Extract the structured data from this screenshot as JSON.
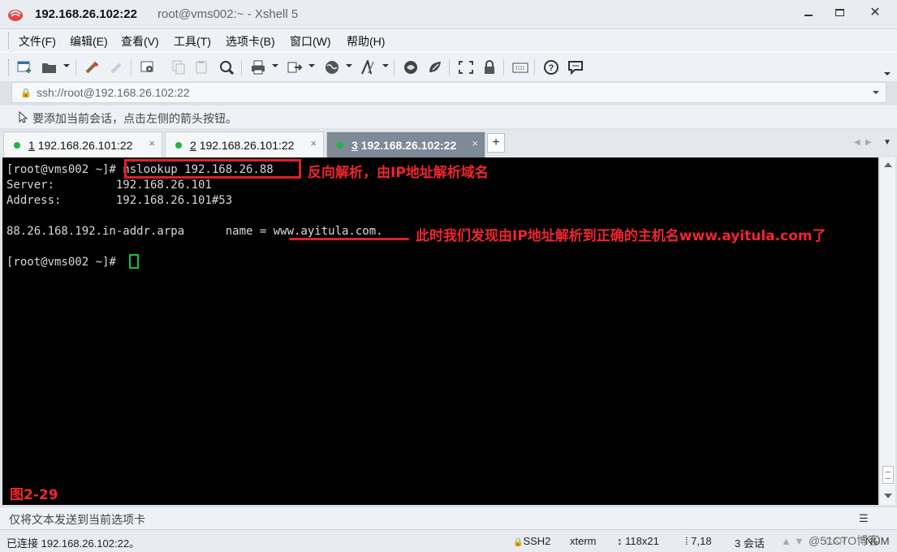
{
  "window": {
    "title_host": "192.168.26.102:22",
    "title_sub": "root@vms002:~ - Xshell 5",
    "minimize_glyph": "▭",
    "maximize_glyph": "□",
    "close_glyph": "✕"
  },
  "menu": [
    "文件(F)",
    "编辑(E)",
    "查看(V)",
    "工具(T)",
    "选项卡(B)",
    "窗口(W)",
    "帮助(H)"
  ],
  "toolbar": {
    "icons": [
      "new-session-icon",
      "open-folder-icon",
      "connect-icon",
      "disconnect-icon",
      "properties-icon",
      "copy-icon",
      "paste-icon",
      "find-icon",
      "print-icon",
      "transfer-icon",
      "globe-icon",
      "font-icon",
      "xftp-icon",
      "xmanager-icon",
      "fullscreen-icon",
      "lock-icon",
      "keyboard-icon",
      "help-icon",
      "chat-icon"
    ]
  },
  "address": {
    "url": "ssh://root@192.168.26.102:22"
  },
  "session_hint": "要添加当前会话，点击左侧的箭头按钮。",
  "tabs": [
    {
      "num": "1",
      "label": "192.168.26.101:22",
      "active": false
    },
    {
      "num": "2",
      "label": "192.168.26.101:22",
      "active": false
    },
    {
      "num": "3",
      "label": "192.168.26.102:22",
      "active": true
    }
  ],
  "tab_close_glyph": "×",
  "tab_add_glyph": "+",
  "terminal": {
    "lines": [
      "[root@vms002 ~]# nslookup 192.168.26.88",
      "Server:         192.168.26.101",
      "Address:        192.168.26.101#53",
      "",
      "88.26.168.192.in-addr.arpa      name = www.ayitula.com.",
      "",
      "[root@vms002 ~]# "
    ],
    "annotation_1": "反向解析，由IP地址解析域名",
    "annotation_2": "此时我们发现由IP地址解析到正确的主机名www.ayitula.com了",
    "figure_label": "图2-29"
  },
  "sendbar": {
    "label": "仅将文本发送到当前选项卡"
  },
  "status": {
    "connection": "已连接 192.168.26.102:22。",
    "protocol": "SSH2",
    "term": "xterm",
    "size": "118x21",
    "cursor": "7,18",
    "sessions": "3 会话",
    "caps": "CAP",
    "num": "NUM",
    "watermark": "@51CTO博客"
  }
}
